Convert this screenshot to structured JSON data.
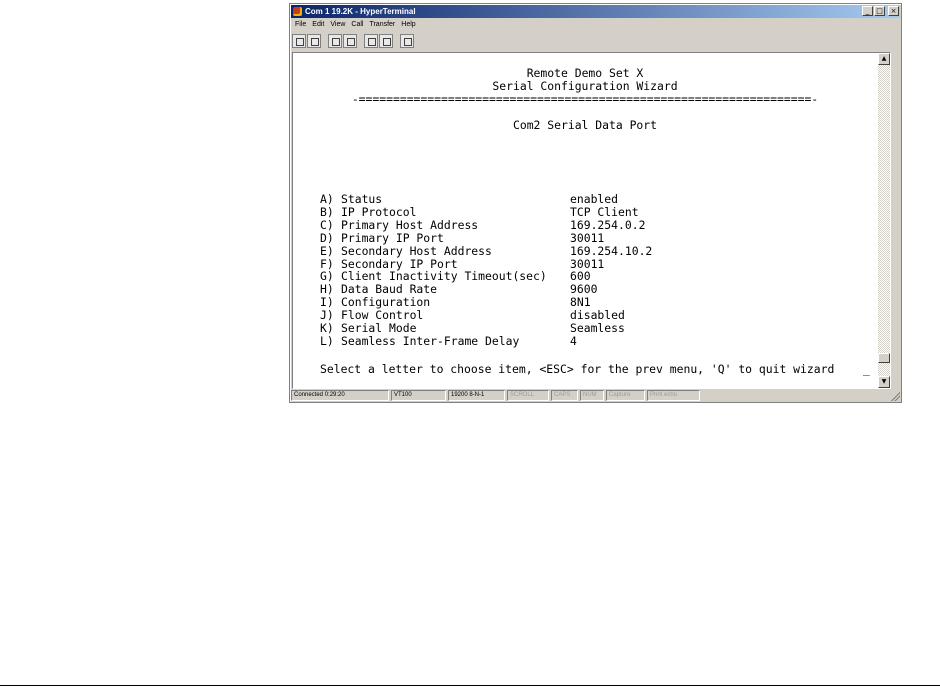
{
  "window": {
    "title": "Com 1 19.2K - HyperTerminal",
    "controls": {
      "minimize": "_",
      "maximize": "□",
      "close": "×"
    }
  },
  "menu": [
    "File",
    "Edit",
    "View",
    "Call",
    "Transfer",
    "Help"
  ],
  "toolbar": [
    "new-icon",
    "open-icon",
    "connect-icon",
    "disconnect-icon",
    "send-icon",
    "receive-icon",
    "properties-icon"
  ],
  "terminal": {
    "header1": "Remote Demo Set X",
    "header2": "Serial Configuration Wizard",
    "rule": "-==================================================================-",
    "section": "Com2 Serial Data Port",
    "items": [
      {
        "key": "A)",
        "label": "Status",
        "value": "enabled"
      },
      {
        "key": "B)",
        "label": "IP Protocol",
        "value": "TCP Client"
      },
      {
        "key": "C)",
        "label": "Primary Host Address",
        "value": "169.254.0.2"
      },
      {
        "key": "D)",
        "label": "Primary IP Port",
        "value": "30011"
      },
      {
        "key": "E)",
        "label": "Secondary Host Address",
        "value": "169.254.10.2"
      },
      {
        "key": "F)",
        "label": "Secondary IP Port",
        "value": "30011"
      },
      {
        "key": "G)",
        "label": "Client Inactivity Timeout(sec)",
        "value": "600"
      },
      {
        "key": "H)",
        "label": "Data Baud Rate",
        "value": "9600"
      },
      {
        "key": "I)",
        "label": "Configuration",
        "value": "8N1"
      },
      {
        "key": "J)",
        "label": "Flow Control",
        "value": "disabled"
      },
      {
        "key": "K)",
        "label": "Serial Mode",
        "value": "Seamless"
      },
      {
        "key": "L)",
        "label": "Seamless Inter-Frame Delay",
        "value": "4"
      }
    ],
    "prompt": "Select a letter to choose item, <ESC> for the prev menu, 'Q' to quit wizard",
    "cursor": "_"
  },
  "scrollbar": {
    "up": "▲",
    "down": "▼"
  },
  "statusbar": {
    "connected": "Connected 0:29:20",
    "emulation": "VT100",
    "settings": "19200 8-N-1",
    "scroll": "SCROLL",
    "caps": "CAPS",
    "num": "NUM",
    "capture": "Capture",
    "print_echo": "Print echo"
  }
}
